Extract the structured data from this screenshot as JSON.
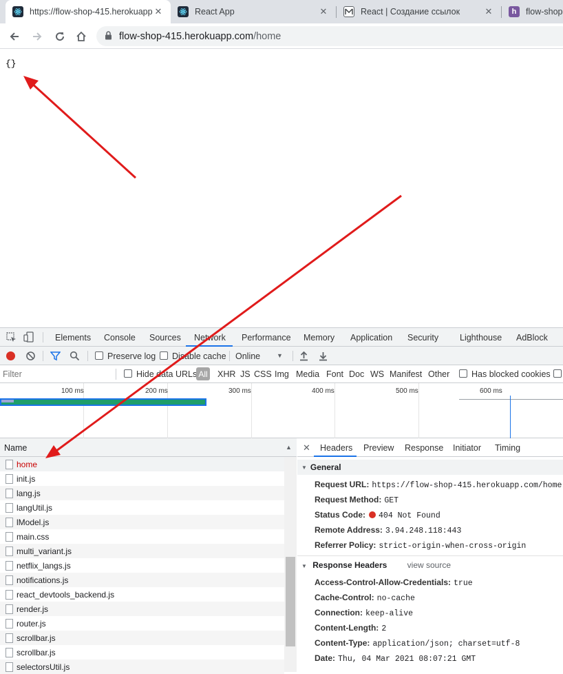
{
  "browser": {
    "tabs": [
      {
        "title": "https://flow-shop-415.herokuapp",
        "active": true,
        "icon": "react-icon"
      },
      {
        "title": "React App",
        "active": false,
        "icon": "react-icon"
      },
      {
        "title": "React | Создание ссылок",
        "active": false,
        "icon": "mail-icon"
      },
      {
        "title": "flow-shop-",
        "active": false,
        "icon": "heroku-icon"
      }
    ],
    "url_host": "flow-shop-415.herokuapp.com",
    "url_path": "/home"
  },
  "page": {
    "body_text": "{}"
  },
  "devtools": {
    "tabs": [
      "Elements",
      "Console",
      "Sources",
      "Network",
      "Performance",
      "Memory",
      "Application",
      "Security",
      "Lighthouse",
      "AdBlock"
    ],
    "active_tab": "Network",
    "toolbar": {
      "preserve_log": "Preserve log",
      "disable_cache": "Disable cache",
      "throttling": "Online"
    },
    "filter": {
      "placeholder": "Filter",
      "hide_data_urls": "Hide data URLs",
      "types": [
        "All",
        "XHR",
        "JS",
        "CSS",
        "Img",
        "Media",
        "Font",
        "Doc",
        "WS",
        "Manifest",
        "Other"
      ],
      "has_blocked_cookies": "Has blocked cookies"
    },
    "overview_ticks": [
      "100 ms",
      "200 ms",
      "300 ms",
      "400 ms",
      "500 ms",
      "600 ms"
    ],
    "list": {
      "column_name": "Name",
      "rows": [
        "home",
        "init.js",
        "lang.js",
        "langUtil.js",
        "lModel.js",
        "main.css",
        "multi_variant.js",
        "netflix_langs.js",
        "notifications.js",
        "react_devtools_backend.js",
        "render.js",
        "router.js",
        "scrollbar.js",
        "scrollbar.js",
        "selectorsUtil.js"
      ]
    },
    "detail": {
      "tabs": [
        "Headers",
        "Preview",
        "Response",
        "Initiator",
        "Timing"
      ],
      "general_title": "General",
      "general": [
        {
          "k": "Request URL:",
          "v": "https://flow-shop-415.herokuapp.com/home"
        },
        {
          "k": "Request Method:",
          "v": "GET"
        },
        {
          "k": "Status Code:",
          "v": "404 Not Found"
        },
        {
          "k": "Remote Address:",
          "v": "3.94.248.118:443"
        },
        {
          "k": "Referrer Policy:",
          "v": "strict-origin-when-cross-origin"
        }
      ],
      "response_title": "Response Headers",
      "view_source": "view source",
      "response": [
        {
          "k": "Access-Control-Allow-Credentials:",
          "v": "true"
        },
        {
          "k": "Cache-Control:",
          "v": "no-cache"
        },
        {
          "k": "Connection:",
          "v": "keep-alive"
        },
        {
          "k": "Content-Length:",
          "v": "2"
        },
        {
          "k": "Content-Type:",
          "v": "application/json; charset=utf-8"
        },
        {
          "k": "Date:",
          "v": "Thu, 04 Mar 2021 08:07:21 GMT"
        }
      ]
    }
  },
  "colors": {
    "accent": "#1a73e8",
    "error": "#c80000",
    "arrow": "#e01b1b",
    "record": "#d93025"
  }
}
